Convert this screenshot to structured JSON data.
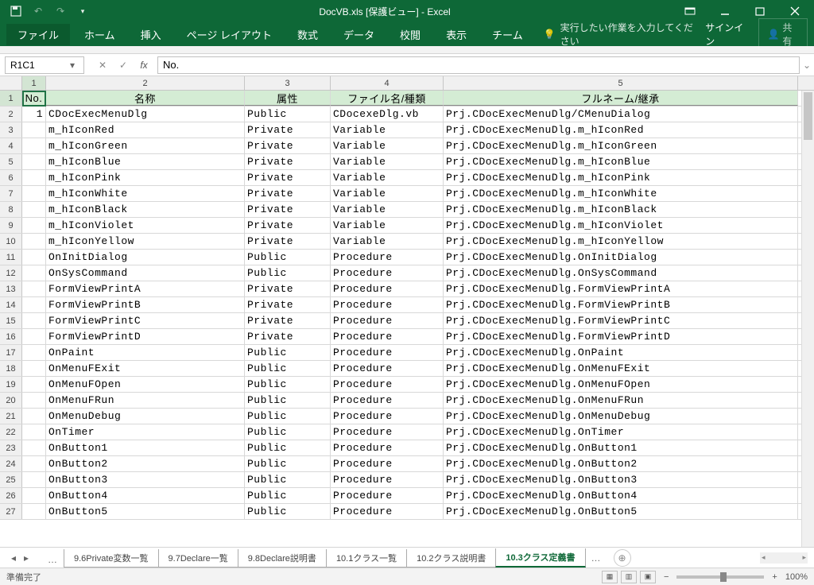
{
  "title": "DocVB.xls [保護ビュー] - Excel",
  "ribbon": {
    "file": "ファイル",
    "home": "ホーム",
    "insert": "挿入",
    "layout": "ページ レイアウト",
    "formulas": "数式",
    "data": "データ",
    "review": "校閲",
    "view": "表示",
    "team": "チーム",
    "tellme": "実行したい作業を入力してください",
    "signin": "サインイン",
    "share": "共有"
  },
  "namebox": "R1C1",
  "formula": "No.",
  "columns": [
    "1",
    "2",
    "3",
    "4",
    "5"
  ],
  "headers": {
    "no": "No.",
    "name": "名称",
    "attr": "属性",
    "file": "ファイル名/種類",
    "full": "フルネーム/継承"
  },
  "rows": [
    {
      "no": "1",
      "name": "CDocExecMenuDlg",
      "attr": "Public",
      "file": "CDocexeDlg.vb",
      "full": "Prj.CDocExecMenuDlg/CMenuDialog"
    },
    {
      "no": "",
      "name": "m_hIconRed",
      "attr": "Private",
      "file": "Variable",
      "full": "Prj.CDocExecMenuDlg.m_hIconRed"
    },
    {
      "no": "",
      "name": "m_hIconGreen",
      "attr": "Private",
      "file": "Variable",
      "full": "Prj.CDocExecMenuDlg.m_hIconGreen"
    },
    {
      "no": "",
      "name": "m_hIconBlue",
      "attr": "Private",
      "file": "Variable",
      "full": "Prj.CDocExecMenuDlg.m_hIconBlue"
    },
    {
      "no": "",
      "name": "m_hIconPink",
      "attr": "Private",
      "file": "Variable",
      "full": "Prj.CDocExecMenuDlg.m_hIconPink"
    },
    {
      "no": "",
      "name": "m_hIconWhite",
      "attr": "Private",
      "file": "Variable",
      "full": "Prj.CDocExecMenuDlg.m_hIconWhite"
    },
    {
      "no": "",
      "name": "m_hIconBlack",
      "attr": "Private",
      "file": "Variable",
      "full": "Prj.CDocExecMenuDlg.m_hIconBlack"
    },
    {
      "no": "",
      "name": "m_hIconViolet",
      "attr": "Private",
      "file": "Variable",
      "full": "Prj.CDocExecMenuDlg.m_hIconViolet"
    },
    {
      "no": "",
      "name": "m_hIconYellow",
      "attr": "Private",
      "file": "Variable",
      "full": "Prj.CDocExecMenuDlg.m_hIconYellow"
    },
    {
      "no": "",
      "name": "OnInitDialog",
      "attr": "Public",
      "file": "Procedure",
      "full": "Prj.CDocExecMenuDlg.OnInitDialog"
    },
    {
      "no": "",
      "name": "OnSysCommand",
      "attr": "Public",
      "file": "Procedure",
      "full": "Prj.CDocExecMenuDlg.OnSysCommand"
    },
    {
      "no": "",
      "name": "FormViewPrintA",
      "attr": "Private",
      "file": "Procedure",
      "full": "Prj.CDocExecMenuDlg.FormViewPrintA"
    },
    {
      "no": "",
      "name": "FormViewPrintB",
      "attr": "Private",
      "file": "Procedure",
      "full": "Prj.CDocExecMenuDlg.FormViewPrintB"
    },
    {
      "no": "",
      "name": "FormViewPrintC",
      "attr": "Private",
      "file": "Procedure",
      "full": "Prj.CDocExecMenuDlg.FormViewPrintC"
    },
    {
      "no": "",
      "name": "FormViewPrintD",
      "attr": "Private",
      "file": "Procedure",
      "full": "Prj.CDocExecMenuDlg.FormViewPrintD"
    },
    {
      "no": "",
      "name": "OnPaint",
      "attr": "Public",
      "file": "Procedure",
      "full": "Prj.CDocExecMenuDlg.OnPaint"
    },
    {
      "no": "",
      "name": "OnMenuFExit",
      "attr": "Public",
      "file": "Procedure",
      "full": "Prj.CDocExecMenuDlg.OnMenuFExit"
    },
    {
      "no": "",
      "name": "OnMenuFOpen",
      "attr": "Public",
      "file": "Procedure",
      "full": "Prj.CDocExecMenuDlg.OnMenuFOpen"
    },
    {
      "no": "",
      "name": "OnMenuFRun",
      "attr": "Public",
      "file": "Procedure",
      "full": "Prj.CDocExecMenuDlg.OnMenuFRun"
    },
    {
      "no": "",
      "name": "OnMenuDebug",
      "attr": "Public",
      "file": "Procedure",
      "full": "Prj.CDocExecMenuDlg.OnMenuDebug"
    },
    {
      "no": "",
      "name": "OnTimer",
      "attr": "Public",
      "file": "Procedure",
      "full": "Prj.CDocExecMenuDlg.OnTimer"
    },
    {
      "no": "",
      "name": "OnButton1",
      "attr": "Public",
      "file": "Procedure",
      "full": "Prj.CDocExecMenuDlg.OnButton1"
    },
    {
      "no": "",
      "name": "OnButton2",
      "attr": "Public",
      "file": "Procedure",
      "full": "Prj.CDocExecMenuDlg.OnButton2"
    },
    {
      "no": "",
      "name": "OnButton3",
      "attr": "Public",
      "file": "Procedure",
      "full": "Prj.CDocExecMenuDlg.OnButton3"
    },
    {
      "no": "",
      "name": "OnButton4",
      "attr": "Public",
      "file": "Procedure",
      "full": "Prj.CDocExecMenuDlg.OnButton4"
    },
    {
      "no": "",
      "name": "OnButton5",
      "attr": "Public",
      "file": "Procedure",
      "full": "Prj.CDocExecMenuDlg.OnButton5"
    }
  ],
  "tabs": [
    "9.6Private変数一覧",
    "9.7Declare一覧",
    "9.8Declare説明書",
    "10.1クラス一覧",
    "10.2クラス説明書",
    "10.3クラス定義書"
  ],
  "status": "準備完了",
  "zoom": "100%"
}
